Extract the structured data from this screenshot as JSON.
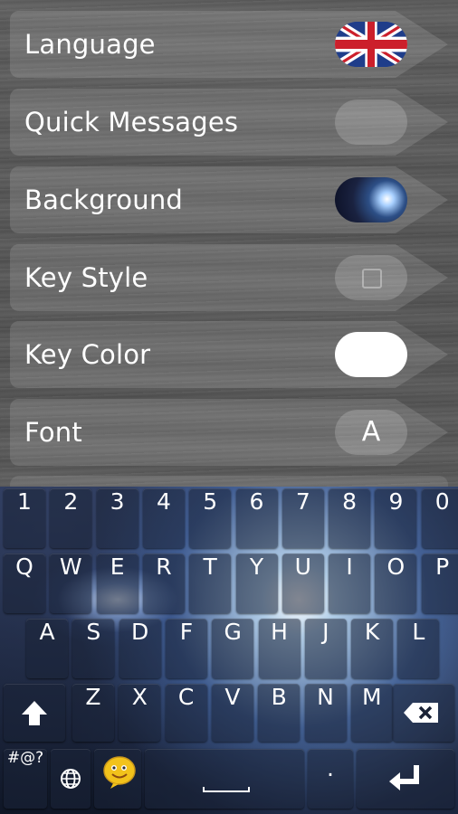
{
  "settings": {
    "items": [
      {
        "label": "Language",
        "control": "flag-uk"
      },
      {
        "label": "Quick Messages",
        "control": "blank"
      },
      {
        "label": "Background",
        "control": "galaxy"
      },
      {
        "label": "Key Style",
        "control": "square"
      },
      {
        "label": "Key Color",
        "control": "white"
      },
      {
        "label": "Font",
        "control": "letter",
        "value": "A"
      }
    ]
  },
  "keyboard": {
    "number_row": [
      "1",
      "2",
      "3",
      "4",
      "5",
      "6",
      "7",
      "8",
      "9",
      "0"
    ],
    "row1": [
      "Q",
      "W",
      "E",
      "R",
      "T",
      "Y",
      "U",
      "I",
      "O",
      "P"
    ],
    "row2": [
      "A",
      "S",
      "D",
      "F",
      "G",
      "H",
      "J",
      "K",
      "L"
    ],
    "row3": [
      "Z",
      "X",
      "C",
      "V",
      "B",
      "N",
      "M"
    ],
    "symbols_key": "#@?",
    "period_key": ".",
    "colors": {
      "key_bg": "#19233a",
      "text": "#ffffff",
      "emoji": "#f2c21b"
    }
  }
}
